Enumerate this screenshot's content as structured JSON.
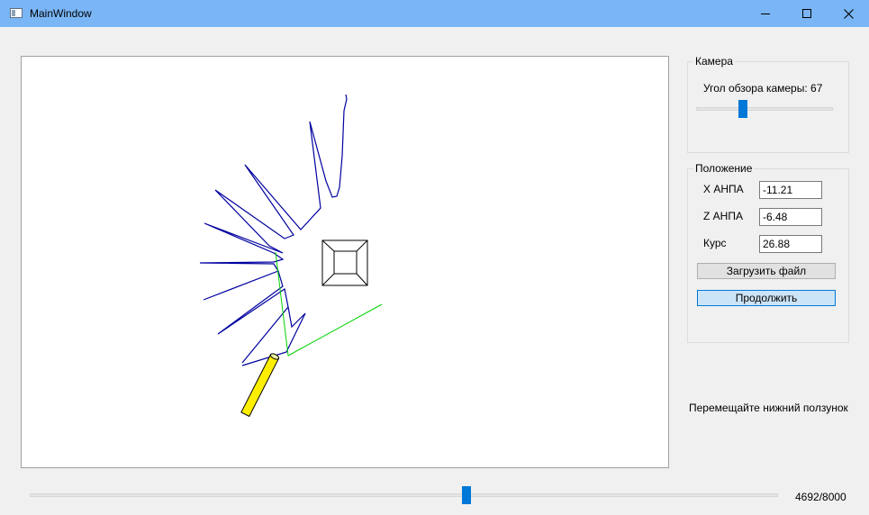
{
  "window": {
    "title": "MainWindow"
  },
  "camera": {
    "group_title": "Камера",
    "fov_label": "Угол обзора камеры: 67",
    "fov_value": 67
  },
  "position": {
    "group_title": "Положение",
    "x_label": "X АНПА",
    "x_value": "-11.21",
    "z_label": "Z АНПА",
    "z_value": "-6.48",
    "heading_label": "Курс",
    "heading_value": "26.88",
    "load_button": "Загрузить файл",
    "continue_button": "Продолжить"
  },
  "hint": "Перемещайте нижний ползунок",
  "timeline": {
    "counter": "4692/8000",
    "current": 4692,
    "total": 8000
  },
  "colors": {
    "trajectory": "#0000a0",
    "view_lines": "#00cc00",
    "vehicle": "#ffee00",
    "accent": "#0078d7",
    "titlebar": "#7ab6f6"
  }
}
